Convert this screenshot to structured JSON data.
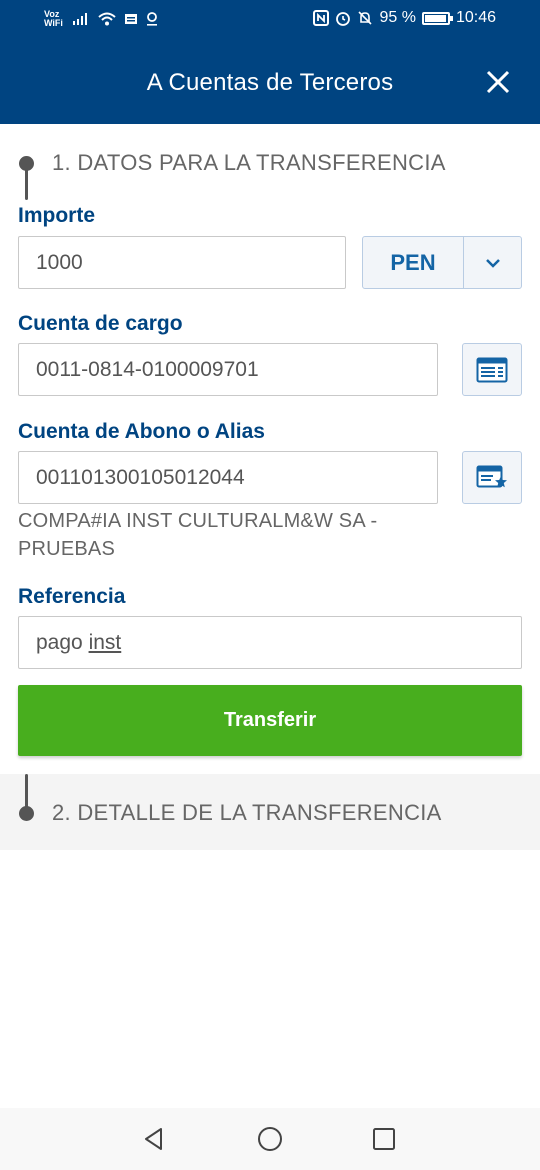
{
  "status_bar": {
    "carrier_line1": "Voz",
    "carrier_line2": "WiFi",
    "battery_text": "95 %",
    "battery_level": 0.95,
    "time": "10:46"
  },
  "header": {
    "title": "A Cuentas de Terceros",
    "close_icon": "close-icon"
  },
  "step1": {
    "title": "1. DATOS PARA LA TRANSFERENCIA"
  },
  "form": {
    "importe_label": "Importe",
    "importe_value": "1000",
    "currency_value": "PEN",
    "cargo_label": "Cuenta de cargo",
    "cargo_value": "0011-0814-0100009701",
    "abono_label": "Cuenta de Abono o Alias",
    "abono_value": "001101300105012044",
    "abono_holder": "COMPA#IA INST CULTURALM&W SA - PRUEBAS",
    "referencia_label": "Referencia",
    "referencia_value_1": "pago ",
    "referencia_value_2": "inst",
    "submit_label": "Transferir"
  },
  "step2": {
    "title": "2. DETALLE DE LA TRANSFERENCIA"
  },
  "colors": {
    "brand": "#004481",
    "accent": "#1464a5",
    "success": "#48ae1e"
  },
  "nav": {
    "back_icon": "back-icon",
    "home_icon": "home-icon",
    "recents_icon": "recents-icon"
  }
}
